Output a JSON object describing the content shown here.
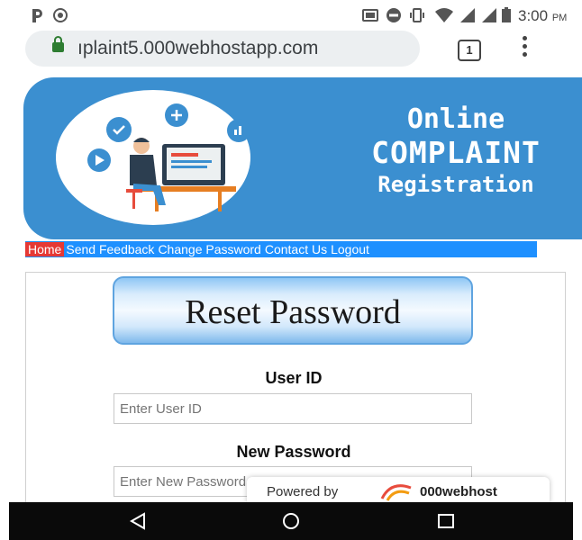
{
  "status_bar": {
    "icons": [
      "parking-icon",
      "signal-alt-icon",
      "cast-icon",
      "dnd-icon",
      "vibrate-icon",
      "wifi-icon",
      "cell-signal-icon",
      "cell-signal-2-icon",
      "battery-icon"
    ],
    "time": "3:00",
    "ampm": "PM"
  },
  "browser": {
    "url": "ıplaint5.000webhostapp.com",
    "tab_count": "1"
  },
  "banner": {
    "title_line1": "Online",
    "title_line2": "COMPLAINT",
    "title_line3": "Registration",
    "color": "#3b8fd0"
  },
  "nav": {
    "items": [
      "Home",
      "Send Feedback",
      "Change Password",
      "Contact Us",
      "Logout"
    ],
    "active_color": "#e53935",
    "bar_color": "#1e90ff"
  },
  "form": {
    "heading": "Reset Password",
    "user_id_label": "User ID",
    "user_id_placeholder": "Enter User ID",
    "new_password_label": "New Password",
    "new_password_placeholder": "Enter New Password"
  },
  "footer_badge": {
    "powered_by": "Powered by",
    "brand": "000webhost"
  },
  "android_nav": {
    "icons": [
      "back-icon",
      "home-icon",
      "recents-icon"
    ]
  }
}
